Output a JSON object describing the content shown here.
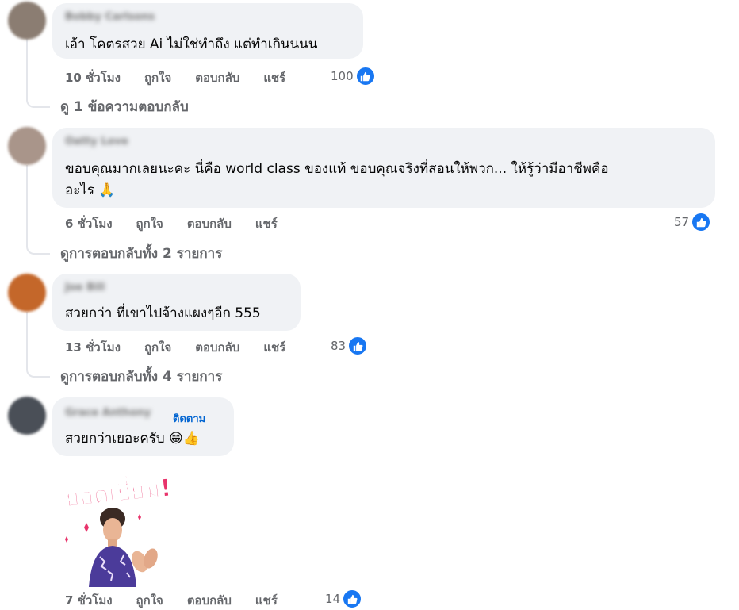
{
  "comments": [
    {
      "author": "Bobby Carlsons",
      "text": "เอ้า โคตรสวย Ai ไม่ใช่ทำถึง แต่ทำเกินนนน",
      "time": "10 ชั่วโมง",
      "like_label": "ถูกใจ",
      "reply_label": "ตอบกลับ",
      "share_label": "แชร์",
      "reactions": "100",
      "view_replies": "ดู 1 ข้อความตอบกลับ",
      "avatar_color": "#8b7d72"
    },
    {
      "author": "Oatty Love",
      "text_line1": "ขอบคุณมากเลยนะคะ นี่คือ world class ของแท้ ขอบคุณจริงที่สอนให้พวก... ให้รู้ว่ามีอาชีพคือ",
      "text_line2": "อะไร 🙏",
      "time": "6 ชั่วโมง",
      "like_label": "ถูกใจ",
      "reply_label": "ตอบกลับ",
      "share_label": "แชร์",
      "reactions": "57",
      "view_replies": "ดูการตอบกลับทั้ง 2 รายการ",
      "avatar_color": "#a9958a"
    },
    {
      "author": "Joe Bill",
      "text": "สวยกว่า ที่เขาไปจ้างแผงๆอีก 555",
      "time": "13 ชั่วโมง",
      "like_label": "ถูกใจ",
      "reply_label": "ตอบกลับ",
      "share_label": "แชร์",
      "reactions": "83",
      "view_replies": "ดูการตอบกลับทั้ง 4 รายการ",
      "avatar_color": "#c4672a"
    },
    {
      "author": "Grace Anthony",
      "follow_label": "ติดตาม",
      "text": "สวยกว่าเยอะครับ 😁👍",
      "time": "7 ชั่วโมง",
      "like_label": "ถูกใจ",
      "reply_label": "ตอบกลับ",
      "share_label": "แชร์",
      "reactions": "14",
      "sticker_text": "ยอดเยี่ยม!",
      "avatar_color": "#4a4f57"
    }
  ],
  "colors": {
    "bubble": "#f0f2f5",
    "meta": "#65676b",
    "like_blue": "#1877f2",
    "sticker_pink": "#e8336b"
  }
}
